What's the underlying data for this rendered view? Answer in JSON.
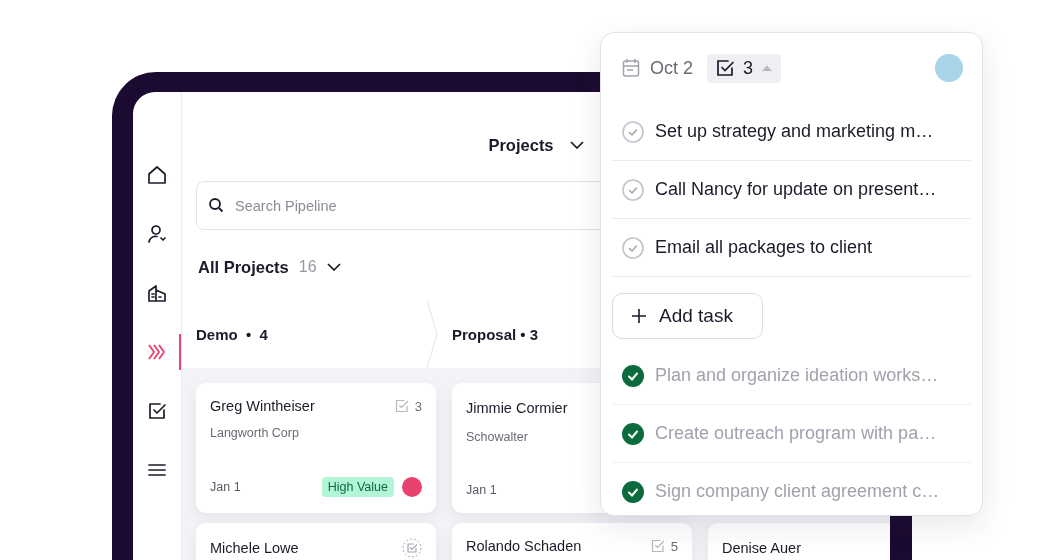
{
  "sidebar": {
    "items": [
      {
        "kind": "home",
        "selected": false
      },
      {
        "kind": "contacts",
        "selected": false
      },
      {
        "kind": "companies",
        "selected": false
      },
      {
        "kind": "pipeline",
        "selected": true
      },
      {
        "kind": "tasks",
        "selected": false
      },
      {
        "kind": "menu",
        "selected": false
      }
    ]
  },
  "header": {
    "title": "Projects"
  },
  "search": {
    "placeholder": "Search Pipeline"
  },
  "view": {
    "label": "All Projects",
    "count": "16"
  },
  "stages": [
    {
      "name": "Demo",
      "separator": "•",
      "count": "4"
    },
    {
      "name": "Proposal",
      "separator": "•",
      "count": "3"
    }
  ],
  "columns": [
    {
      "cards": [
        {
          "name": "Greg Wintheiser",
          "tasks": "3",
          "company": "Langworth Corp",
          "date": "Jan 1",
          "tag": "High Value",
          "avatar": true
        },
        {
          "name": "Michele Lowe"
        }
      ]
    },
    {
      "cards": [
        {
          "name": "Jimmie Cormier",
          "company": "Schowalter",
          "date": "Jan 1"
        },
        {
          "name": "Rolando Schaden",
          "tasks": "5"
        }
      ]
    },
    {
      "cards": [
        {
          "name": "Denise Auer"
        }
      ]
    }
  ],
  "popup": {
    "date": "Oct 2",
    "task_count": "3",
    "add_label": "Add task",
    "tasks": [
      {
        "text": "Set up strategy and marketing m…",
        "done": false
      },
      {
        "text": "Call Nancy for update on present…",
        "done": false
      },
      {
        "text": "Email all packages to client",
        "done": false
      },
      {
        "text": "Plan and organize ideation works…",
        "done": true
      },
      {
        "text": "Create outreach program with pa…",
        "done": true
      },
      {
        "text": "Sign company client agreement c…",
        "done": true
      }
    ]
  }
}
